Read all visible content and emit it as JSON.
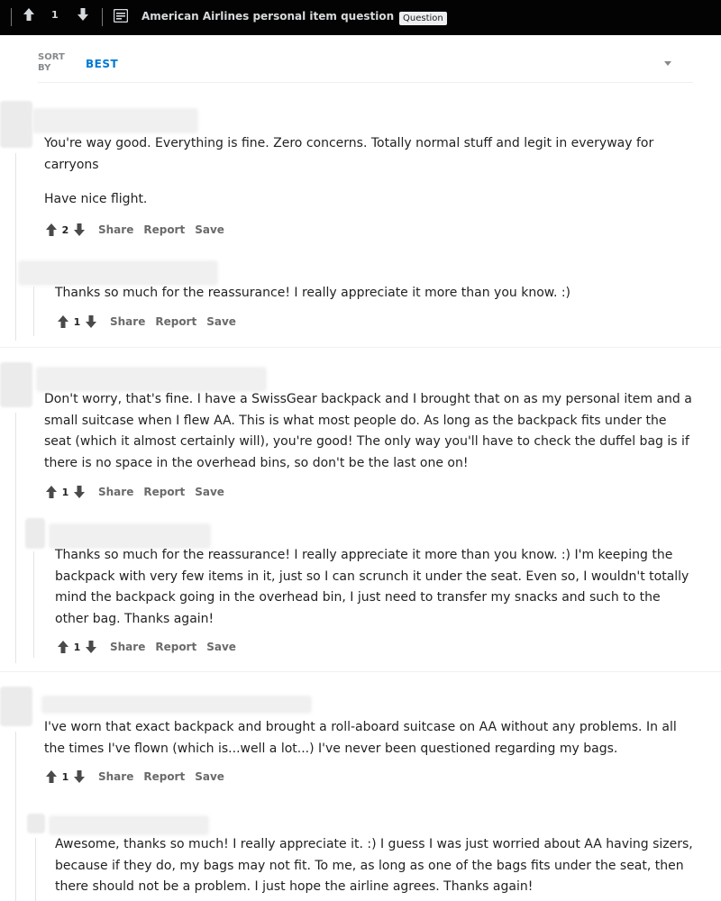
{
  "post_bar": {
    "score": "1",
    "title": "American Airlines personal item question",
    "flair": "Question"
  },
  "sort": {
    "label": "SORT BY",
    "value": "BEST"
  },
  "comments": [
    {
      "paragraphs": [
        "You're way good. Everything is fine. Zero concerns. Totally normal stuff and legit in everyway for carryons",
        "Have nice flight."
      ],
      "score": "2",
      "actions": [
        "Share",
        "Report",
        "Save"
      ]
    },
    {
      "paragraphs": [
        "Thanks so much for the reassurance! I really appreciate it more than you know. :)"
      ],
      "score": "1",
      "actions": [
        "Share",
        "Report",
        "Save"
      ]
    },
    {
      "paragraphs": [
        "Don't worry, that's fine. I have a SwissGear backpack and I brought that on as my personal item and a small suitcase when I flew AA. This is what most people do. As long as the backpack fits under the seat (which it almost certainly will), you're good! The only way you'll have to check the duffel bag is if there is no space in the overhead bins, so don't be the last one on!"
      ],
      "score": "1",
      "actions": [
        "Share",
        "Report",
        "Save"
      ]
    },
    {
      "paragraphs": [
        "Thanks so much for the reassurance! I really appreciate it more than you know. :) I'm keeping the backpack with very few items in it, just so I can scrunch it under the seat. Even so, I wouldn't totally mind the backpack going in the overhead bin, I just need to transfer my snacks and such to the other bag. Thanks again!"
      ],
      "score": "1",
      "actions": [
        "Share",
        "Report",
        "Save"
      ]
    },
    {
      "paragraphs": [
        "I've worn that exact backpack and brought a roll-aboard suitcase on AA without any problems. In all the times I've flown (which is...well a lot...) I've never been questioned regarding my bags."
      ],
      "score": "1",
      "actions": [
        "Share",
        "Report",
        "Save"
      ]
    },
    {
      "paragraphs": [
        "Awesome, thanks so much! I really appreciate it. :) I guess I was just worried about AA having sizers, because if they do, my bags may not fit. To me, as long as one of the bags fits under the seat, then there should not be a problem. I just hope the airline agrees. Thanks again!"
      ],
      "score": "",
      "actions": []
    }
  ],
  "icons": {
    "upvote": "arrow-up-icon",
    "downvote": "arrow-down-icon",
    "post": "post-text-icon",
    "sort_caret": "caret-down-icon"
  },
  "colors": {
    "topbar_bg": "#030303",
    "sort_accent": "#0079d3",
    "action_text": "#6a6a6a"
  }
}
